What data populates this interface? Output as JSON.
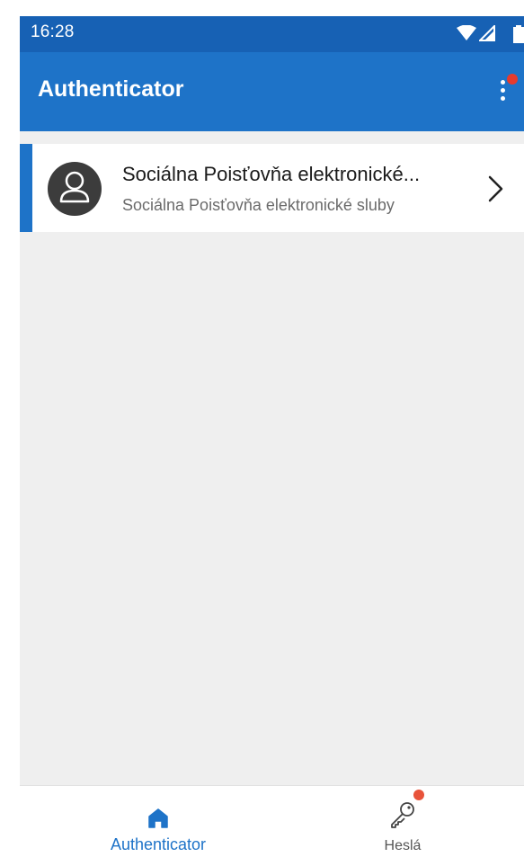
{
  "status_bar": {
    "time": "16:28",
    "icons": [
      "wifi-icon",
      "signal-icon",
      "battery-icon"
    ]
  },
  "app_bar": {
    "title": "Authenticator",
    "menu_icon": "more-vertical-icon",
    "has_notification_badge": true
  },
  "accounts": [
    {
      "name": "Sociálna Poisťovňa elektronické...",
      "subtitle": "Sociálna Poisťovňa elektronické sluby",
      "icon": "person-icon"
    }
  ],
  "bottom_nav": {
    "items": [
      {
        "label": "Authenticator",
        "icon": "home-icon",
        "active": true
      },
      {
        "label": "Heslá",
        "icon": "key-icon",
        "active": false,
        "badge": true
      }
    ]
  },
  "colors": {
    "status_bar": "#1761b4",
    "app_bar": "#1e73c8",
    "accent": "#1e73c8",
    "badge": "#e63b2e",
    "background": "#efefef"
  }
}
